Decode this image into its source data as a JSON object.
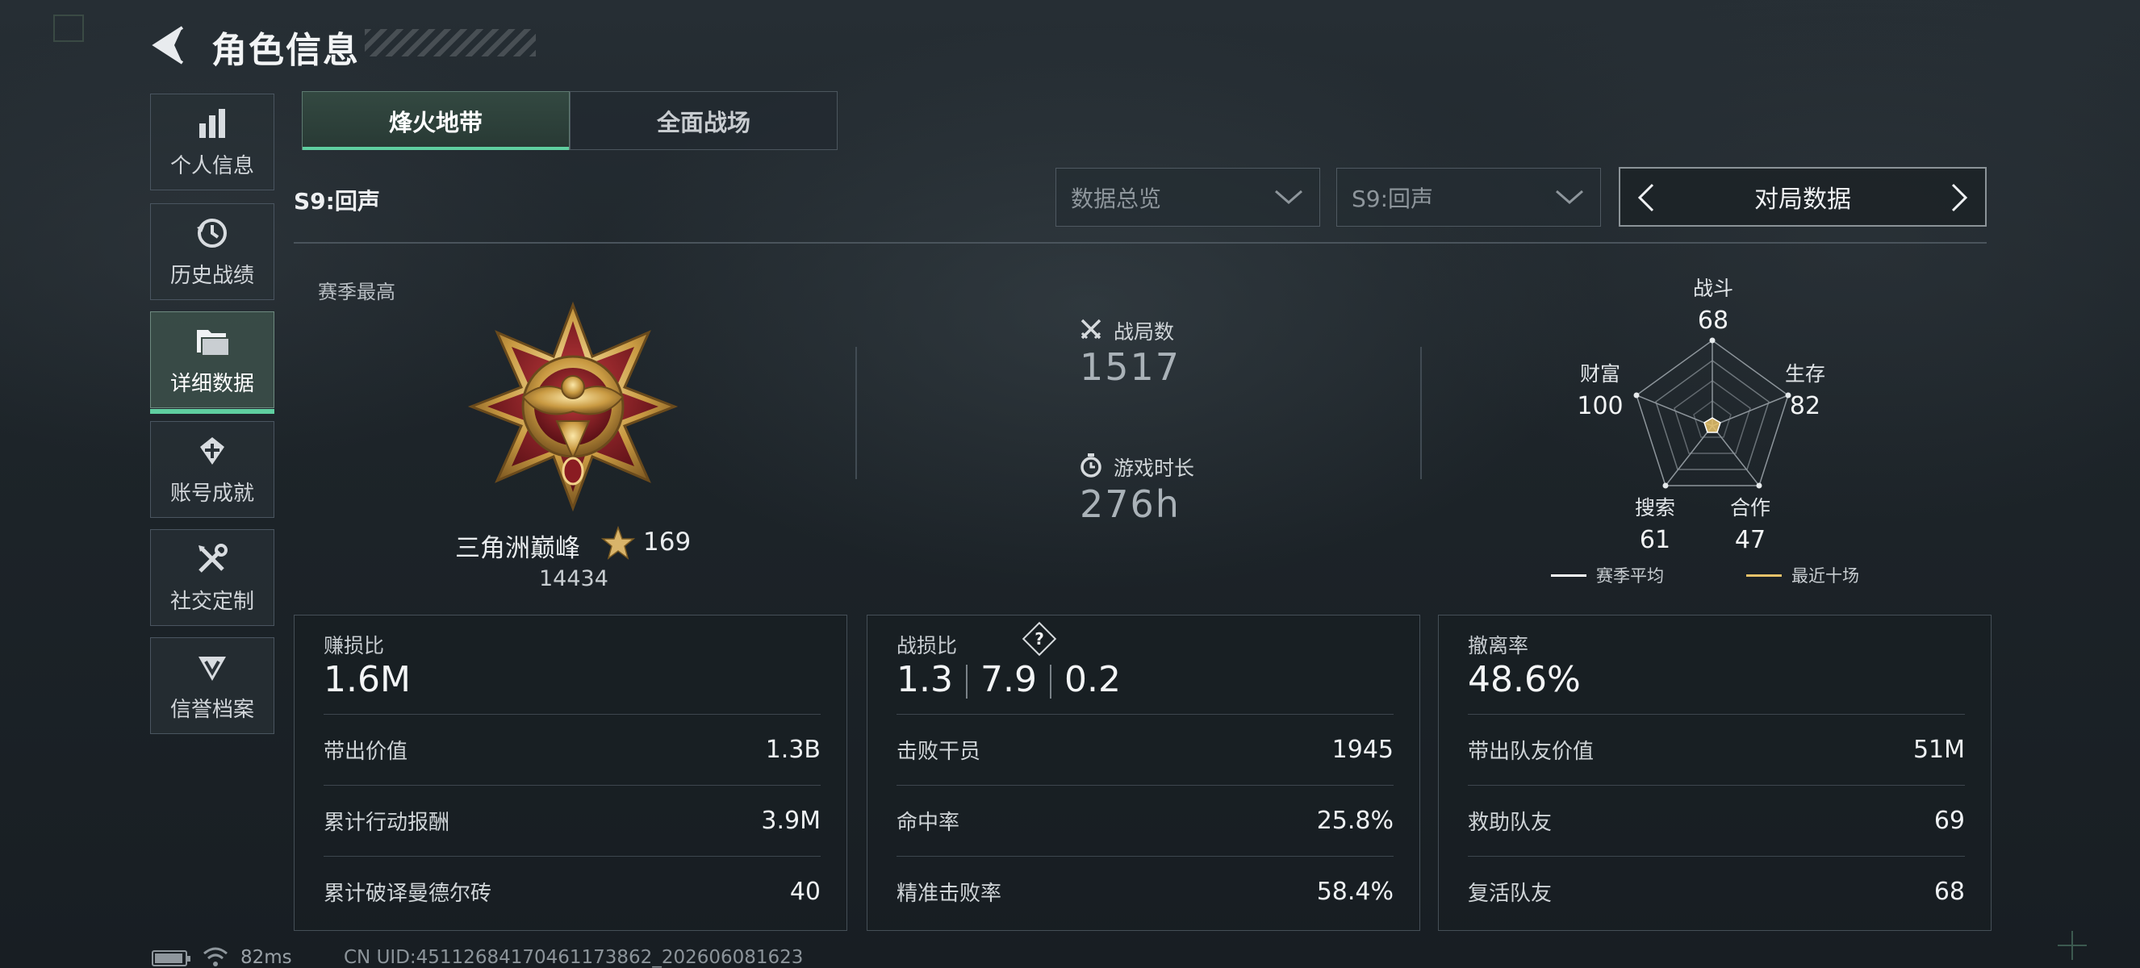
{
  "header": {
    "title": "角色信息"
  },
  "sidebar": {
    "items": [
      {
        "label": "个人信息",
        "icon": "bar-chart-icon"
      },
      {
        "label": "历史战绩",
        "icon": "history-clock-icon"
      },
      {
        "label": "详细数据",
        "icon": "folder-icon",
        "active": true
      },
      {
        "label": "账号成就",
        "icon": "achievement-medal-icon"
      },
      {
        "label": "社交定制",
        "icon": "tools-icon"
      },
      {
        "label": "信誉档案",
        "icon": "shield-emblem-icon"
      }
    ]
  },
  "mode_tabs": [
    {
      "label": "烽火地带",
      "active": true
    },
    {
      "label": "全面战场",
      "active": false
    }
  ],
  "season_label": "S9:回声",
  "filters": {
    "data_type": "数据总览",
    "season": "S9:回声",
    "view": "对局数据"
  },
  "season_best": {
    "label": "赛季最高",
    "rank_name": "三角洲巅峰",
    "stars": "169",
    "score": "14434"
  },
  "summary": {
    "matches_label": "战局数",
    "matches_value": "1517",
    "playtime_label": "游戏时长",
    "playtime_value": "276h"
  },
  "radar": {
    "axes": [
      {
        "label": "战斗",
        "value": "68"
      },
      {
        "label": "生存",
        "value": "82"
      },
      {
        "label": "合作",
        "value": "47"
      },
      {
        "label": "搜索",
        "value": "61"
      },
      {
        "label": "财富",
        "value": "100"
      }
    ],
    "legend": [
      {
        "label": "赛季平均",
        "color": "#ffffff"
      },
      {
        "label": "最近十场",
        "color": "#e7c26a"
      }
    ]
  },
  "cards": [
    {
      "title": "赚损比",
      "main": "1.6M",
      "rows": [
        {
          "label": "带出价值",
          "value": "1.3B"
        },
        {
          "label": "累计行动报酬",
          "value": "3.9M"
        },
        {
          "label": "累计破译曼德尔砖",
          "value": "40"
        }
      ]
    },
    {
      "title": "战损比",
      "help": "?",
      "main_parts": [
        "1.3",
        "7.9",
        "0.2"
      ],
      "rows": [
        {
          "label": "击败干员",
          "value": "1945"
        },
        {
          "label": "命中率",
          "value": "25.8%"
        },
        {
          "label": "精准击败率",
          "value": "58.4%"
        }
      ]
    },
    {
      "title": "撤离率",
      "main": "48.6%",
      "rows": [
        {
          "label": "带出队友价值",
          "value": "51M"
        },
        {
          "label": "救助队友",
          "value": "69"
        },
        {
          "label": "复活队友",
          "value": "68"
        }
      ]
    }
  ],
  "footer": {
    "ping": "82ms",
    "uid": "CN UID:4511268417046117386​2_202606081623"
  },
  "colors": {
    "accent": "#5fcfa0",
    "gold": "#e7c26a",
    "medal_red": "#8a1c22"
  }
}
